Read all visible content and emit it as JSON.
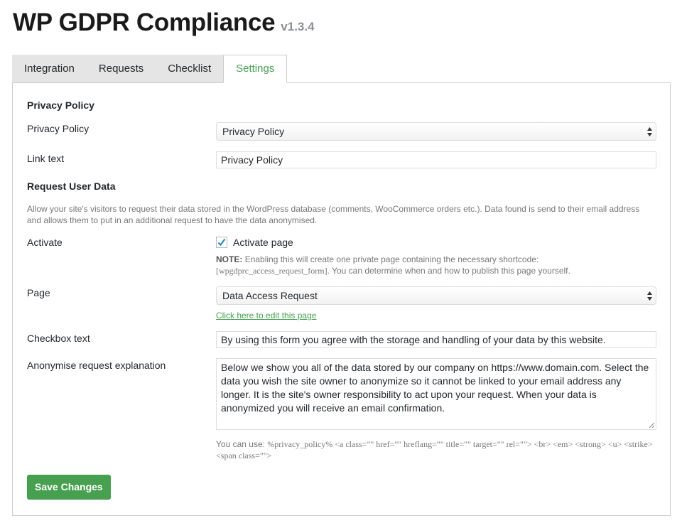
{
  "header": {
    "title": "WP GDPR Compliance",
    "version": "v1.3.4"
  },
  "tabs": [
    {
      "label": "Integration"
    },
    {
      "label": "Requests"
    },
    {
      "label": "Checklist"
    },
    {
      "label": "Settings",
      "active": true
    }
  ],
  "privacy": {
    "section_title": "Privacy Policy",
    "policy_label": "Privacy Policy",
    "policy_select_value": "Privacy Policy",
    "link_text_label": "Link text",
    "link_text_value": "Privacy Policy"
  },
  "request": {
    "section_title": "Request User Data",
    "description_line1": "Allow your site's visitors to request their data stored in the WordPress database (comments, WooCommerce orders etc.). Data found is send to their email address",
    "description_line2": "and allows them to put in an additional request to have the data anonymised.",
    "activate_label": "Activate",
    "activate_checkbox_label": "Activate page",
    "activate_checked": true,
    "note_prefix": "NOTE:",
    "note_text": "Enabling this will create one private page containing the necessary shortcode:",
    "note_shortcode": "[wpgdprc_access_request_form]",
    "note_text2": ". You can determine when and how to publish this page yourself.",
    "page_label": "Page",
    "page_select_value": "Data Access Request",
    "edit_page_link": "Click here to edit this page",
    "checkbox_text_label": "Checkbox text",
    "checkbox_text_value": "By using this form you agree with the storage and handling of your data by this website.",
    "anonymise_label": "Anonymise request explanation",
    "anonymise_value": "Below we show you all of the data stored by our company on https://www.domain.com. Select the data you wish the site owner to anonymize so it cannot be linked to your email address any longer. It is the site's owner responsibility to act upon your request. When your data is anonymized you will receive an email confirmation.",
    "allowed_prefix": "You can use:",
    "allowed_line1": "%privacy_policy% <a class=\"\" href=\"\" hreflang=\"\" title=\"\" target=\"\" rel=\"\"> <br> <em> <strong> <u> <strike>",
    "allowed_line2": "<span class=\"\">"
  },
  "actions": {
    "save_label": "Save Changes"
  },
  "colors": {
    "accent": "#46a050",
    "tab_bg": "#e5e5e5",
    "border": "#cccccc"
  },
  "icons": {
    "select_arrows": "select-arrows-icon",
    "check": "checkmark-icon",
    "resize": "resize-handle-icon"
  }
}
